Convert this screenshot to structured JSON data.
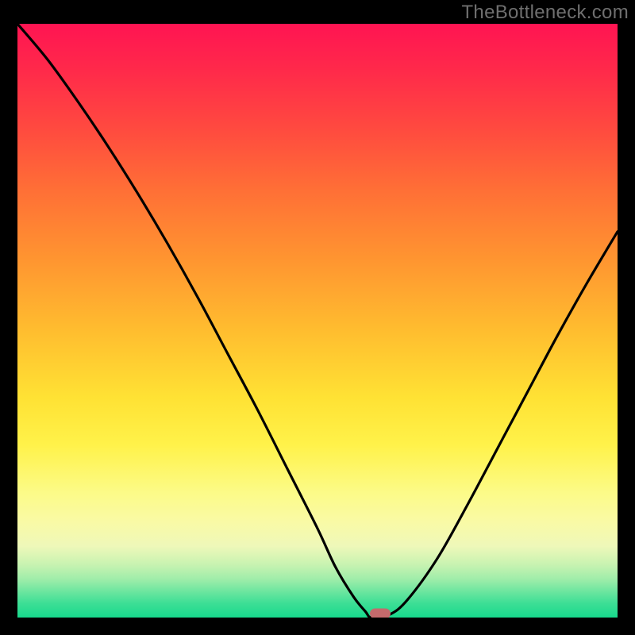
{
  "watermark": "TheBottleneck.com",
  "chart_data": {
    "type": "line",
    "title": "",
    "xlabel": "",
    "ylabel": "",
    "xlim": [
      0,
      100
    ],
    "ylim": [
      0,
      100
    ],
    "grid": false,
    "legend": false,
    "series": [
      {
        "name": "bottleneck-curve",
        "x": [
          0,
          5,
          10,
          15,
          20,
          25,
          30,
          35,
          40,
          45,
          50,
          53,
          56,
          58,
          59,
          62,
          65,
          70,
          75,
          80,
          85,
          90,
          95,
          100
        ],
        "y": [
          100,
          94,
          87,
          79.5,
          71.5,
          63,
          54,
          44.5,
          35,
          25,
          15,
          8.5,
          3.5,
          1,
          0,
          0.5,
          3,
          10,
          19,
          28.5,
          38,
          47.5,
          56.5,
          65
        ]
      }
    ],
    "marker": {
      "x": 60.5,
      "y": 0
    },
    "gradient_stops": [
      {
        "pos": 0,
        "color": "#ff1452"
      },
      {
        "pos": 50,
        "color": "#ffbe2f"
      },
      {
        "pos": 80,
        "color": "#fcfb88"
      },
      {
        "pos": 100,
        "color": "#17d98c"
      }
    ]
  }
}
